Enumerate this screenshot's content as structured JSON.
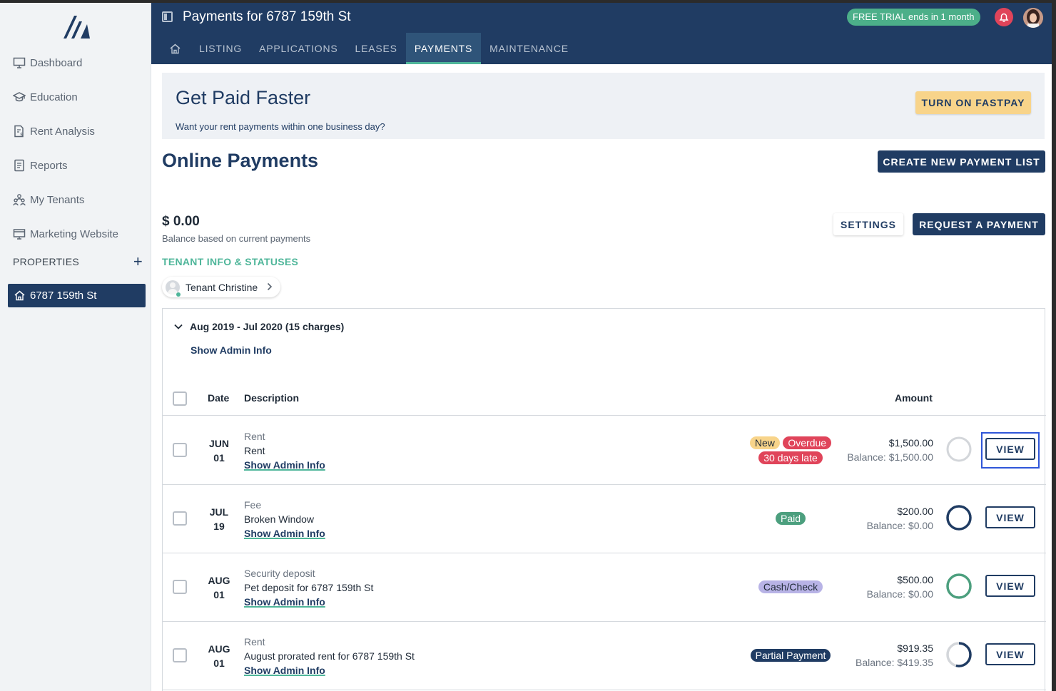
{
  "sidebar": {
    "items": [
      {
        "label": "Dashboard",
        "icon": "monitor-icon"
      },
      {
        "label": "Education",
        "icon": "graduation-cap-icon"
      },
      {
        "label": "Rent Analysis",
        "icon": "document-dollar-icon"
      },
      {
        "label": "Reports",
        "icon": "report-icon"
      },
      {
        "label": "My Tenants",
        "icon": "people-icon"
      },
      {
        "label": "Marketing Website",
        "icon": "website-icon"
      }
    ],
    "properties_label": "PROPERTIES",
    "add_label": "+",
    "property": "6787 159th St"
  },
  "header": {
    "title": "Payments for 6787 159th St",
    "trial": "FREE TRIAL ends in 1 month",
    "tabs": [
      "LISTING",
      "APPLICATIONS",
      "LEASES",
      "PAYMENTS",
      "MAINTENANCE"
    ],
    "active_tab": "PAYMENTS"
  },
  "banner": {
    "title": "Get Paid Faster",
    "subtitle": "Want your rent payments within one business day?",
    "button": "TURN ON FASTPAY"
  },
  "page": {
    "title": "Online Payments",
    "create_button": "CREATE NEW PAYMENT LIST",
    "balance": "$ 0.00",
    "balance_sub": "Balance based on current payments",
    "settings_button": "SETTINGS",
    "request_button": "REQUEST A PAYMENT",
    "tenant_heading": "TENANT INFO & STATUSES",
    "tenant_chip": "Tenant Christine"
  },
  "table": {
    "group_label": "Aug 2019 - Jul 2020 (15 charges)",
    "show_admin": "Show Admin Info",
    "headers": {
      "date": "Date",
      "description": "Description",
      "amount": "Amount"
    },
    "view_label": "VIEW",
    "rows": [
      {
        "month": "JUN",
        "day": "01",
        "category": "Rent",
        "name": "Rent",
        "admin": "Show Admin Info",
        "badges": [
          "New",
          "Overdue",
          "30 days late"
        ],
        "amount": "$1,500.00",
        "balance": "Balance: $1,500.00",
        "paid_fraction": 0
      },
      {
        "month": "JUL",
        "day": "19",
        "category": "Fee",
        "name": "Broken Window",
        "admin": "Show Admin Info",
        "badges": [
          "Paid"
        ],
        "amount": "$200.00",
        "balance": "Balance: $0.00",
        "paid_fraction": 1
      },
      {
        "month": "AUG",
        "day": "01",
        "category": "Security deposit",
        "name": "Pet deposit for 6787 159th St",
        "admin": "Show Admin Info",
        "badges": [
          "Cash/Check"
        ],
        "amount": "$500.00",
        "balance": "Balance: $0.00",
        "paid_fraction": 1
      },
      {
        "month": "AUG",
        "day": "01",
        "category": "Rent",
        "name": "August prorated rent for 6787 159th St",
        "admin": "Show Admin Info",
        "badges": [
          "Partial Payment"
        ],
        "amount": "$919.35",
        "balance": "Balance: $419.35",
        "paid_fraction": 0.54
      }
    ]
  },
  "colors": {
    "navy": "#203c63",
    "green": "#4fb69a",
    "red": "#e0445a",
    "yellow": "#f8d48a",
    "focus_blue": "#2f56d8"
  }
}
